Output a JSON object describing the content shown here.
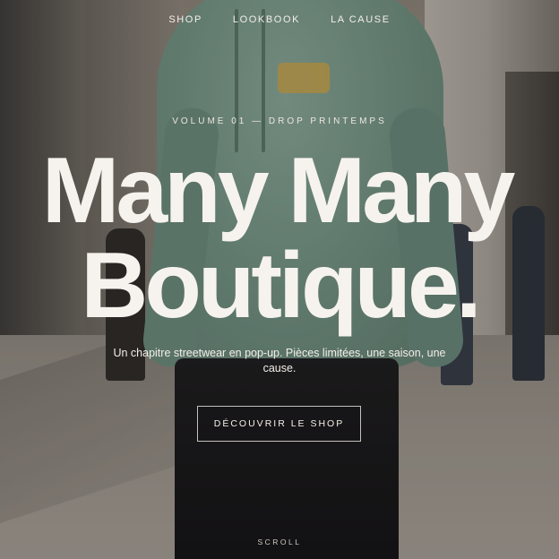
{
  "nav": {
    "items": [
      {
        "label": "SHOP"
      },
      {
        "label": "LOOKBOOK"
      },
      {
        "label": "LA CAUSE"
      }
    ]
  },
  "hero": {
    "eyebrow": "VOLUME 01 — DROP PRINTEMPS",
    "title_line1": "Many Many",
    "title_line2": "Boutique.",
    "subtitle": "Un chapitre streetwear en pop-up. Pièces limitées, une saison, une cause.",
    "cta_label": "DÉCOUVRIR LE SHOP",
    "scroll_label": "SCROLL"
  },
  "colors": {
    "text": "#f6f3ee",
    "hoodie": "#6f8f80"
  }
}
